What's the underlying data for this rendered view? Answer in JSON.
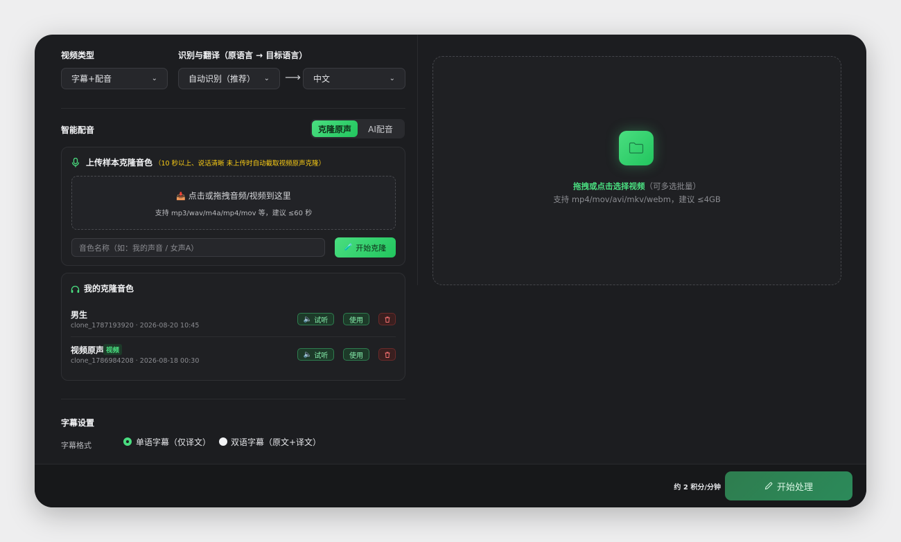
{
  "video_type": {
    "label": "视频类型",
    "value": "字幕+配音"
  },
  "translate": {
    "label": "识别与翻译（原语言 → 目标语言）",
    "source": "自动识别（推荐）",
    "target": "中文",
    "arrow": "⟶"
  },
  "dubbing": {
    "title": "智能配音",
    "tabs": [
      "克隆原声",
      "AI配音"
    ]
  },
  "upload_sample": {
    "icon": "microphone-icon",
    "title": "上传样本克隆音色",
    "hint": "（10 秒以上、说话清晰 未上传时自动截取视频原声克隆）",
    "drop_text": "点击或拖拽音频/视频到这里",
    "drop_sub": "支持 mp3/wav/m4a/mp4/mov 等，建议 ≤60 秒",
    "name_placeholder": "音色名称（如：我的声音 / 女声A）",
    "clone_button": "开始克隆"
  },
  "my_voices": {
    "title": "我的克隆音色",
    "items": [
      {
        "name": "男生",
        "badge": "",
        "meta": "clone_1787193920 · 2026-08-20 10:45",
        "listen": "试听",
        "use": "使用"
      },
      {
        "name": "视频原声",
        "badge": "视频",
        "meta": "clone_1786984208 · 2026-08-18 00:30",
        "listen": "试听",
        "use": "使用"
      }
    ]
  },
  "subtitle": {
    "title": "字幕设置",
    "format_label": "字幕格式",
    "options": [
      "单语字幕（仅译文）",
      "双语字幕（原文+译文）"
    ],
    "selected": 0
  },
  "upload_video": {
    "title": "拖拽或点击选择视频",
    "title_suffix": "（可多选批量）",
    "sub": "支持 mp4/mov/avi/mkv/webm，建议 ≤4GB"
  },
  "footer": {
    "cost": "约 2 积分/分钟",
    "process_button": "开始处理"
  },
  "colors": {
    "accent": "#4ade80",
    "background": "#1c1d20",
    "warning": "#facc15"
  }
}
